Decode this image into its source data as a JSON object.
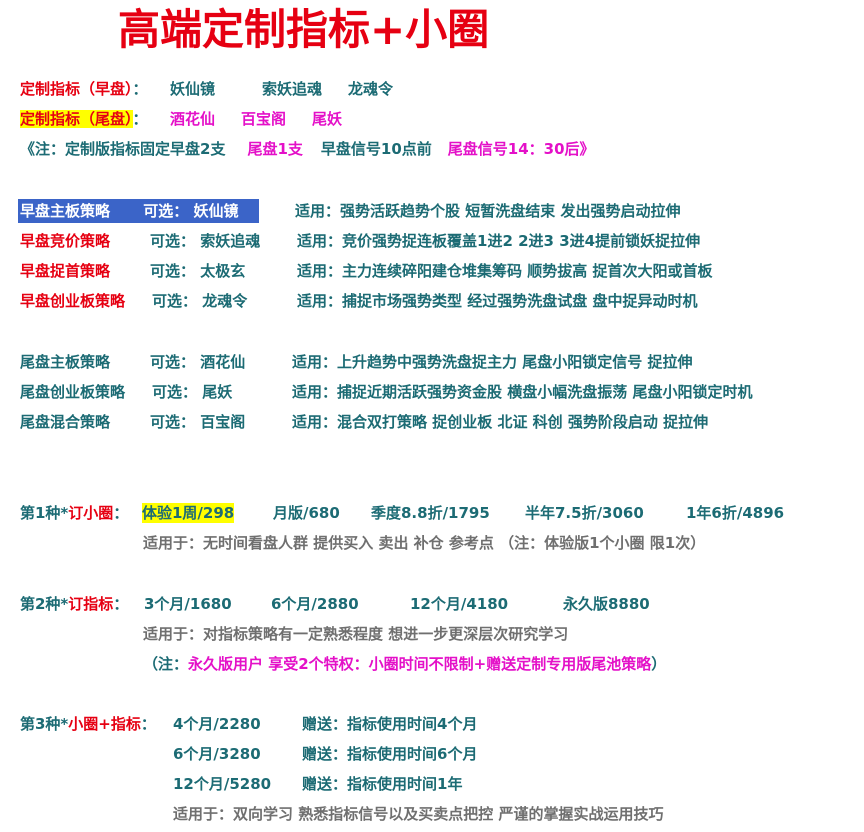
{
  "title": "高端定制指标+小圈",
  "intro": {
    "early_label": "定制指标（早盘）",
    "colon": "：",
    "early_items": [
      "妖仙镜",
      "索妖追魂",
      "龙魂令"
    ],
    "late_label": "定制指标（尾盘）",
    "late_items": [
      "酒花仙",
      "百宝阁",
      "尾妖"
    ],
    "note_prefix": "《注：定制版指标固定早盘2支",
    "note_late": "尾盘1支",
    "note_signal_early": "早盘信号10点前",
    "note_signal_late": "尾盘信号14：30后》"
  },
  "early_strategies": [
    {
      "name": "早盘主板策略",
      "optional": "可选：  妖仙镜",
      "applies": "适用：强势活跃趋势个股 短暂洗盘结束  发出强势启动拉伸"
    },
    {
      "name": "早盘竞价策略",
      "optional": "可选：  索妖追魂",
      "applies": "适用：竞价强势捉连板覆盖1进2   2进3    3进4提前锁妖捉拉伸"
    },
    {
      "name": "早盘捉首策略",
      "optional": "可选：  太极玄",
      "applies": "适用：主力连续碎阳建仓堆集筹码  顺势拔高 捉首次大阳或首板"
    },
    {
      "name": "早盘创业板策略",
      "optional": "可选：  龙魂令",
      "applies": "适用：捕捉市场强势类型 经过强势洗盘试盘 盘中捉异动时机"
    }
  ],
  "late_strategies": [
    {
      "name": "尾盘主板策略",
      "optional": "可选：   酒花仙",
      "applies": "适用：上升趋势中强势洗盘捉主力 尾盘小阳锁定信号 捉拉伸"
    },
    {
      "name": "尾盘创业板策略",
      "optional": "可选：   尾妖",
      "applies": "适用：捕捉近期活跃强势资金股 横盘小幅洗盘振荡 尾盘小阳锁定时机"
    },
    {
      "name": "尾盘混合策略",
      "optional": "可选：   百宝阁",
      "applies": "适用：混合双打策略 捉创业板 北证  科创 强势阶段启动 捉拉伸"
    }
  ],
  "plan1": {
    "label_a": "第1种*",
    "label_b": "订小圈",
    "label_c": "：",
    "trial": "体验1周/298",
    "prices": [
      "月版/680",
      "季度8.8折/1795",
      "半年7.5折/3060",
      "1年6折/4896"
    ],
    "applies": "适用于：无时间看盘人群 提供买入 卖出 补仓 参考点  （注：体验版1个小圈 限1次）"
  },
  "plan2": {
    "label_a": "第2种*",
    "label_b": "订指标",
    "label_c": "：",
    "prices": [
      "3个月/1680",
      "6个月/2880",
      "12个月/4180",
      "永久版8880"
    ],
    "applies": "适用于：对指标策略有一定熟悉程度  想进一步更深层次研究学习",
    "note_a": "（注：",
    "note_b": "永久版用户 享受2个特权：小圈时间不限制+赠送定制专用版尾池策略",
    "note_c": "）"
  },
  "plan3": {
    "label_a": "第3种*",
    "label_b": "小圈+指标",
    "label_c": "：",
    "rows": [
      {
        "price": "4个月/2280",
        "gift": "赠送：指标使用时间4个月"
      },
      {
        "price": "6个月/3280",
        "gift": "赠送：指标使用时间6个月"
      },
      {
        "price": "12个月/5280",
        "gift": "赠送：指标使用时间1年"
      }
    ],
    "applies": "适用于：双向学习 熟悉指标信号以及买卖点把控 严谨的掌握实战运用技巧"
  },
  "colors": {
    "red": "#e60012",
    "teal": "#1c6b74",
    "magenta": "#e410c8",
    "gray": "#6f6f6f",
    "highlight_yellow": "#ffff00",
    "highlight_blue": "#3b64c8"
  }
}
